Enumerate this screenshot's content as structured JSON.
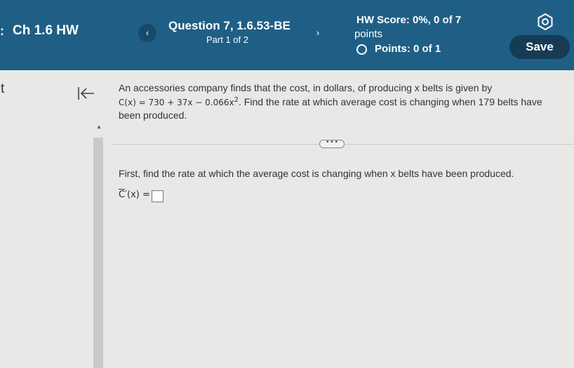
{
  "header": {
    "menu_icon": "menu-icon",
    "assignment_title": "Ch 1.6 HW",
    "prev_label": "‹",
    "next_label": "›",
    "question_title": "Question 7, 1.6.53-BE",
    "question_part": "Part 1 of 2",
    "hw_score": "HW Score: 0%, 0 of 7",
    "hw_score_units": "points",
    "points": "Points: 0 of 1",
    "save_label": "Save",
    "settings_icon": "gear-icon",
    "colors": {
      "header_bg": "#1f5f86",
      "save_bg": "#163b55"
    }
  },
  "sidebar": {
    "letter": "t",
    "collapse_icon": "collapse-left-icon"
  },
  "problem": {
    "text_before": "An accessories company finds that the cost, in dollars, of producing x belts is given by",
    "formula": "C(x) = 730 + 37x − 0.066x",
    "exponent": "2",
    "text_after": ". Find the rate at which average cost is changing when 179 belts have been produced."
  },
  "more_button": "• • •",
  "instruction": "First, find the rate at which the average cost is changing when x belts have been produced.",
  "answer": {
    "c": "C",
    "label_rest": "′(x) =",
    "value": ""
  }
}
